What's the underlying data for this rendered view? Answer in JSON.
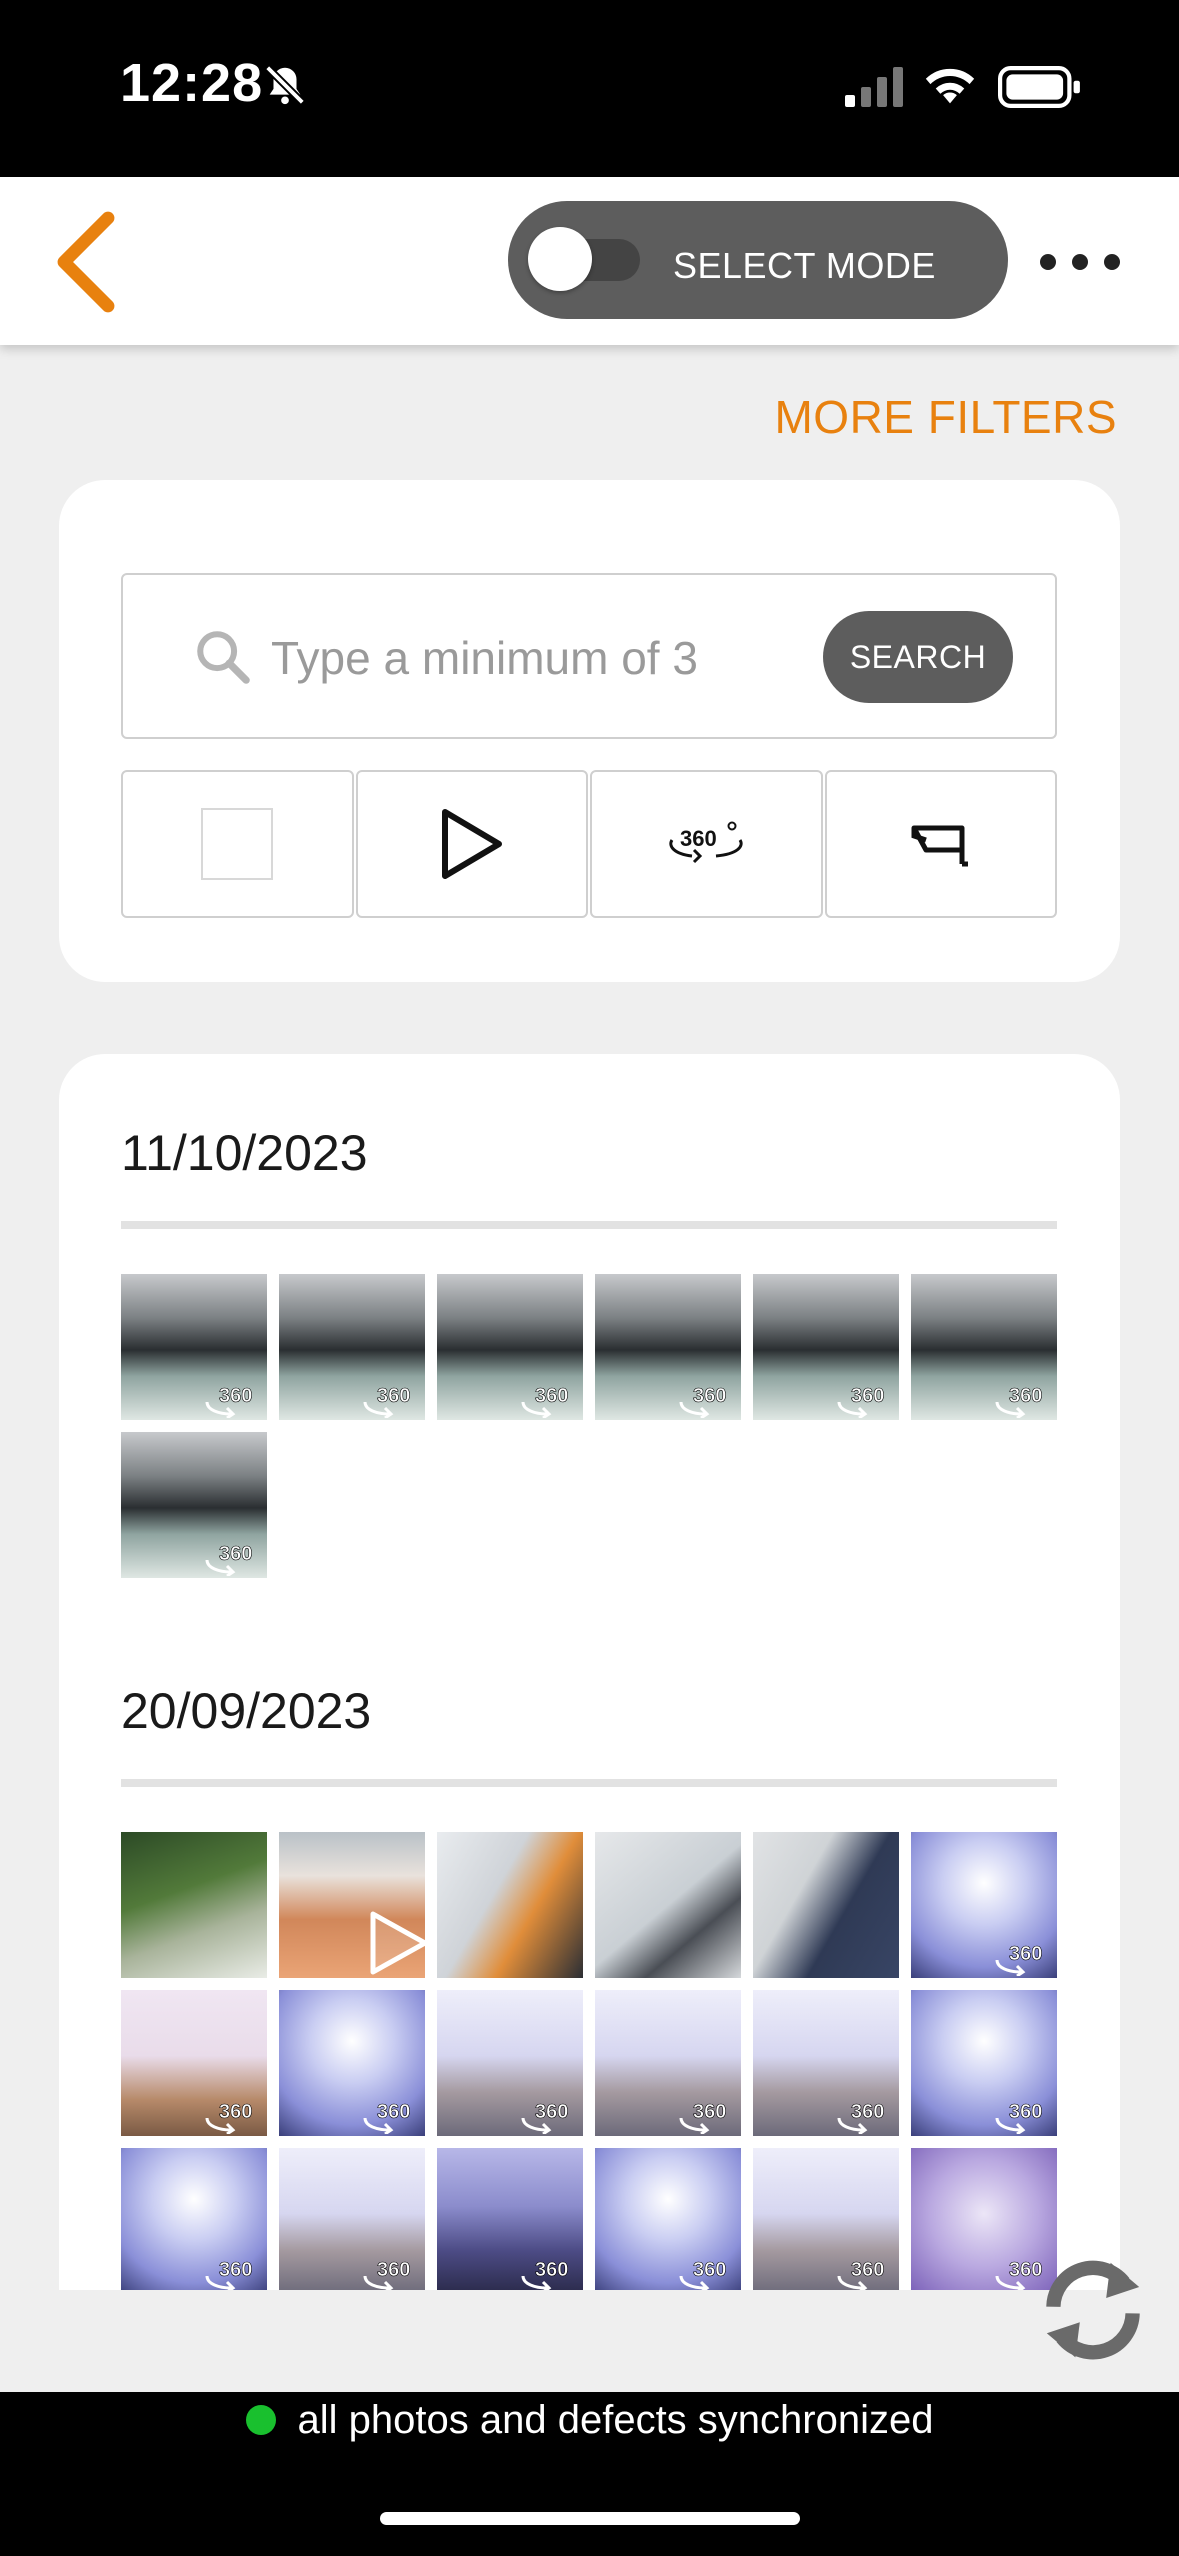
{
  "status_bar": {
    "time": "12:28",
    "icons": [
      "bell-off-icon",
      "cellular-signal-icon",
      "wifi-icon",
      "battery-icon"
    ]
  },
  "header": {
    "back_icon": "chevron-left-icon",
    "select_mode_label": "SELECT MODE",
    "select_mode_on": false,
    "more_icon": "ellipsis-icon"
  },
  "filters": {
    "more_filters_label": "MORE FILTERS",
    "search_placeholder": "Type a minimum of 3",
    "search_button_label": "SEARCH",
    "type_buttons": [
      {
        "name": "photo",
        "icon": "square-photo-icon"
      },
      {
        "name": "video",
        "icon": "play-icon"
      },
      {
        "name": "360",
        "icon": "rotate-360-icon",
        "label": "360"
      },
      {
        "name": "camera",
        "icon": "security-camera-icon"
      }
    ]
  },
  "gallery": {
    "badge_label": "360",
    "groups": [
      {
        "date": "11/10/2023",
        "thumbs": [
          {
            "kind": "360",
            "scene": "office-dark"
          },
          {
            "kind": "360",
            "scene": "office-dark"
          },
          {
            "kind": "360",
            "scene": "office-dark"
          },
          {
            "kind": "360",
            "scene": "office-dark"
          },
          {
            "kind": "360",
            "scene": "office-dark"
          },
          {
            "kind": "360",
            "scene": "office-dark"
          },
          {
            "kind": "360",
            "scene": "office-dark"
          }
        ]
      },
      {
        "date": "20/09/2023",
        "thumbs": [
          {
            "kind": "photo",
            "scene": "plant"
          },
          {
            "kind": "video",
            "scene": "screen-orange"
          },
          {
            "kind": "photo",
            "scene": "laptop-orange"
          },
          {
            "kind": "photo",
            "scene": "desk-cable"
          },
          {
            "kind": "photo",
            "scene": "laptop-code"
          },
          {
            "kind": "360",
            "scene": "room-blue"
          },
          {
            "kind": "360",
            "scene": "room-warm"
          },
          {
            "kind": "360",
            "scene": "room-blue"
          },
          {
            "kind": "360",
            "scene": "room-light"
          },
          {
            "kind": "360",
            "scene": "room-light"
          },
          {
            "kind": "360",
            "scene": "room-light"
          },
          {
            "kind": "360",
            "scene": "room-blue"
          },
          {
            "kind": "360",
            "scene": "room-blue"
          },
          {
            "kind": "360",
            "scene": "room-light"
          },
          {
            "kind": "360",
            "scene": "room-dark"
          },
          {
            "kind": "360",
            "scene": "room-blue"
          },
          {
            "kind": "360",
            "scene": "room-light"
          },
          {
            "kind": "360",
            "scene": "room-purple"
          }
        ]
      }
    ]
  },
  "sync": {
    "sync_icon": "sync-icon",
    "status_text": "all photos and defects synchronized",
    "status_color": "#19c02e"
  },
  "colors": {
    "accent": "#e8810f",
    "toggle_bg": "#5d5d5d"
  }
}
